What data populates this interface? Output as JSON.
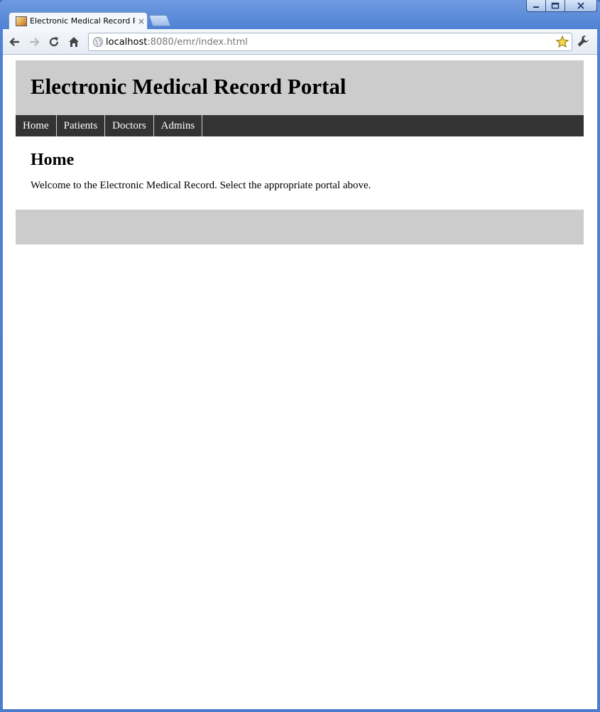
{
  "browser": {
    "tab_title": "Electronic Medical Record Portal",
    "tab_close": "×",
    "url_host": "localhost",
    "url_rest": ":8080/emr/index.html",
    "icons": {
      "back": "back-arrow-icon",
      "forward": "forward-arrow-icon",
      "reload": "reload-icon",
      "home": "home-icon",
      "globe": "globe-icon",
      "star": "star-icon",
      "wrench": "wrench-icon",
      "minimize": "minimize-icon",
      "maximize": "maximize-icon",
      "close": "close-icon"
    }
  },
  "site": {
    "title": "Electronic Medical Record Portal",
    "nav": [
      {
        "label": "Home"
      },
      {
        "label": "Patients"
      },
      {
        "label": "Doctors"
      },
      {
        "label": "Admins"
      }
    ],
    "heading": "Home",
    "welcome": "Welcome to the Electronic Medical Record. Select the appropriate portal above."
  },
  "colors": {
    "header_bg": "#cccccc",
    "nav_bg": "#333333",
    "nav_text": "#ffffff",
    "footer_bg": "#cccccc"
  }
}
